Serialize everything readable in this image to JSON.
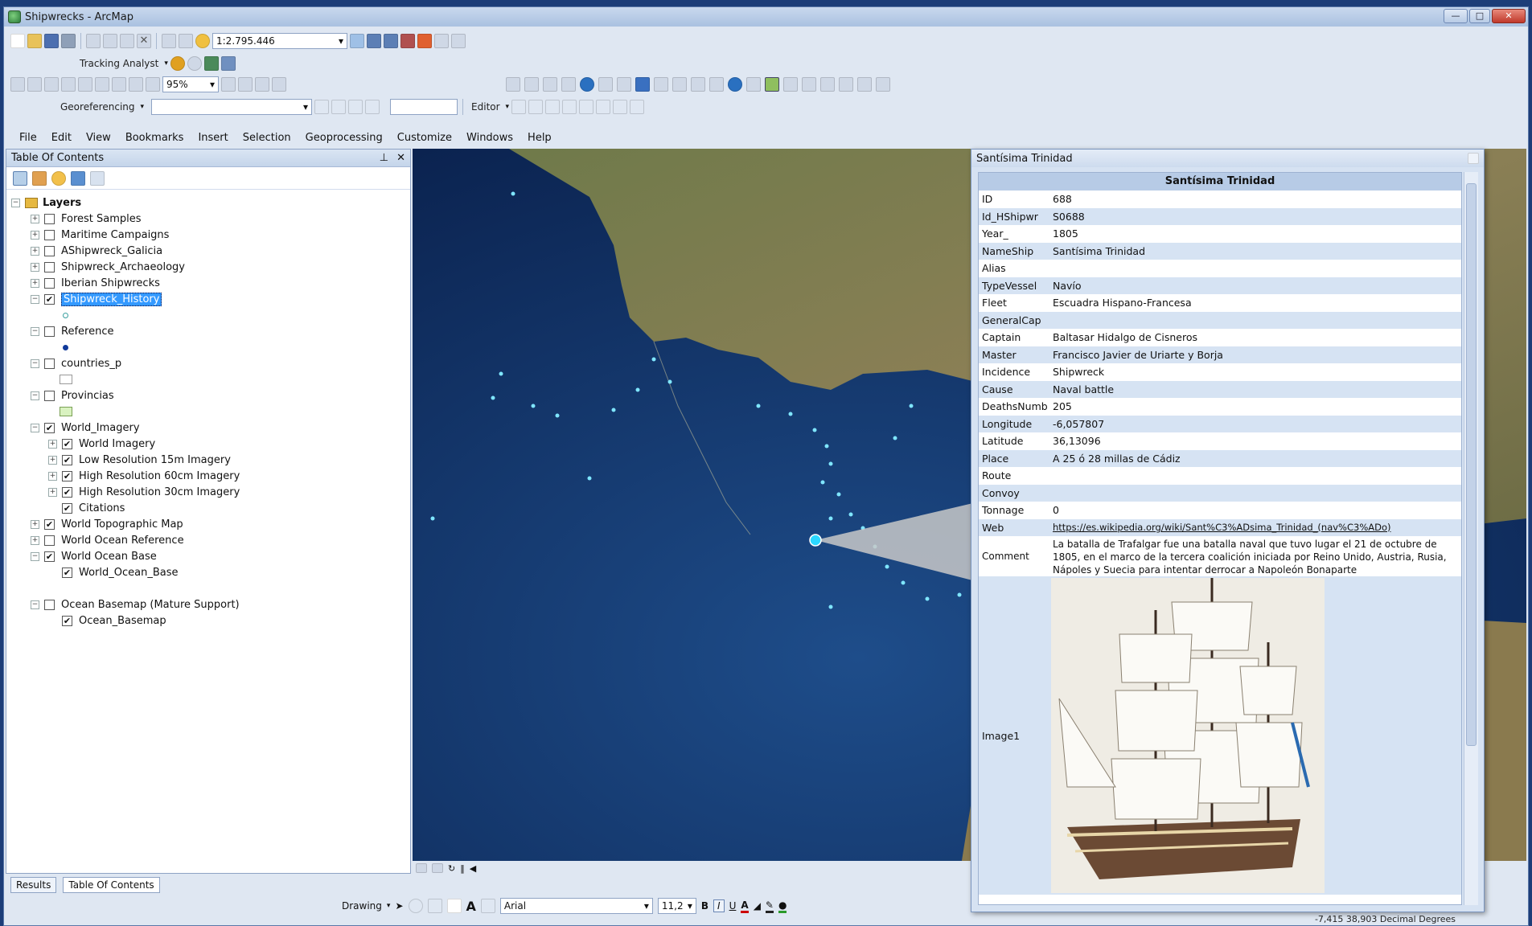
{
  "window": {
    "title": "Shipwrecks - ArcMap"
  },
  "toolbar": {
    "scale": "1:2.795.446",
    "tracking": "Tracking Analyst",
    "zoom_pct": "95%",
    "georef": "Georeferencing",
    "editor": "Editor"
  },
  "menu": [
    "File",
    "Edit",
    "View",
    "Bookmarks",
    "Insert",
    "Selection",
    "Geoprocessing",
    "Customize",
    "Windows",
    "Help"
  ],
  "toc": {
    "title": "Table Of Contents",
    "pin": "✄",
    "close": "✕",
    "root": "Layers",
    "layers": [
      "Forest Samples",
      "Maritime Campaigns",
      "AShipwreck_Galicia",
      "Shipwreck_Archaeology",
      "Iberian Shipwrecks",
      "Shipwreck_History",
      "Reference",
      "countries_p",
      "Provincias",
      "World_Imagery",
      "World Imagery",
      "Low Resolution 15m Imagery",
      "High Resolution 60cm Imagery",
      "High Resolution 30cm Imagery",
      "Citations",
      "World Topographic Map",
      "World Ocean Reference",
      "World Ocean Base",
      "World_Ocean_Base",
      "Ocean Basemap (Mature Support)",
      "Ocean_Basemap"
    ],
    "results_tab": "Results",
    "toc_tab": "Table Of Contents"
  },
  "popup": {
    "window_title": "Santísima Trinidad",
    "header": "Santísima Trinidad",
    "fields": [
      {
        "k": "ID",
        "v": "688"
      },
      {
        "k": "Id_HShipwr",
        "v": "S0688"
      },
      {
        "k": "Year_",
        "v": "1805"
      },
      {
        "k": "NameShip",
        "v": "Santísima Trinidad"
      },
      {
        "k": "Alias",
        "v": ""
      },
      {
        "k": "TypeVessel",
        "v": "Navío"
      },
      {
        "k": "Fleet",
        "v": "Escuadra Hispano-Francesa"
      },
      {
        "k": "GeneralCap",
        "v": ""
      },
      {
        "k": "Captain",
        "v": "Baltasar Hidalgo de Cisneros"
      },
      {
        "k": "Master",
        "v": "Francisco Javier de Uriarte y Borja"
      },
      {
        "k": "Incidence",
        "v": "Shipwreck"
      },
      {
        "k": "Cause",
        "v": "Naval battle"
      },
      {
        "k": "DeathsNumb",
        "v": "205"
      },
      {
        "k": "Longitude",
        "v": "-6,057807"
      },
      {
        "k": "Latitude",
        "v": "36,13096"
      },
      {
        "k": "Place",
        "v": "A 25 ó 28 millas de Cádiz"
      },
      {
        "k": "Route",
        "v": ""
      },
      {
        "k": "Convoy",
        "v": ""
      },
      {
        "k": "Tonnage",
        "v": "0"
      }
    ],
    "web_label": "Web",
    "web_url": "https://es.wikipedia.org/wiki/Sant%C3%ADsima_Trinidad_(nav%C3%ADo)",
    "comment_label": "Comment",
    "comment": "La batalla de Trafalgar fue una batalla naval que tuvo lugar el 21 de octubre de 1805, en el marco de la tercera coalición iniciada por Reino Unido, Austria, Rusia, Nápoles y Suecia para intentar derrocar a Napoleón Bonaparte",
    "image_label": "Image1"
  },
  "drawing": {
    "label": "Drawing",
    "font": "Arial",
    "size": "11,2"
  },
  "status": {
    "coords": "-7,415  38,903 Decimal Degrees"
  }
}
